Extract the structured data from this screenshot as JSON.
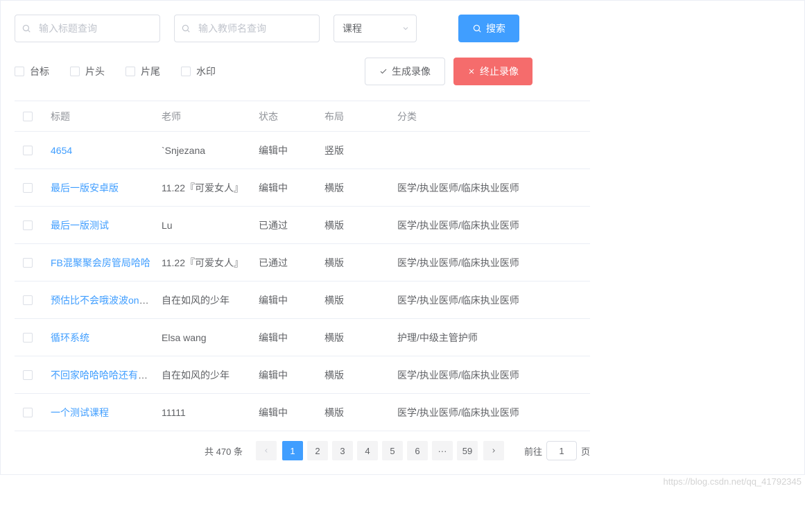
{
  "search": {
    "title_placeholder": "输入标题查询",
    "teacher_placeholder": "输入教师名查询",
    "type_value": "课程",
    "search_btn": "搜索"
  },
  "options": {
    "logo": "台标",
    "intro": "片头",
    "outro": "片尾",
    "watermark": "水印",
    "generate_btn": "生成录像",
    "stop_btn": "终止录像"
  },
  "table": {
    "headers": {
      "title": "标题",
      "teacher": "老师",
      "status": "状态",
      "layout": "布局",
      "category": "分类"
    },
    "rows": [
      {
        "title": "4654",
        "teacher": "`Snjezana",
        "status": "编辑中",
        "layout": "竖版",
        "category": ""
      },
      {
        "title": "最后一版安卓版",
        "teacher": "11.22『可爱女人』",
        "status": "编辑中",
        "layout": "横版",
        "category": "医学/执业医师/临床执业医师"
      },
      {
        "title": "最后一版测试",
        "teacher": "Lu",
        "status": "已通过",
        "layout": "横版",
        "category": "医学/执业医师/临床执业医师"
      },
      {
        "title": "FB混聚聚会房管局哈哈",
        "teacher": "11.22『可爱女人』",
        "status": "已通过",
        "layout": "横版",
        "category": "医学/执业医师/临床执业医师"
      },
      {
        "title": "预估比不会哦波波on年农历",
        "teacher": "自在如风的少年",
        "status": "编辑中",
        "layout": "横版",
        "category": "医学/执业医师/临床执业医师"
      },
      {
        "title": "循环系统",
        "teacher": "Elsa wang",
        "status": "编辑中",
        "layout": "横版",
        "category": "护理/中级主管护师"
      },
      {
        "title": "不回家哈哈哈哈还有个不不",
        "teacher": "自在如风的少年",
        "status": "编辑中",
        "layout": "横版",
        "category": "医学/执业医师/临床执业医师"
      },
      {
        "title": "一个测试课程",
        "teacher": "11111",
        "status": "编辑中",
        "layout": "横版",
        "category": "医学/执业医师/临床执业医师"
      }
    ]
  },
  "pagination": {
    "total_text": "共 470 条",
    "pages": [
      "1",
      "2",
      "3",
      "4",
      "5",
      "6",
      "···",
      "59"
    ],
    "active_page": "1",
    "goto_prefix": "前往",
    "goto_value": "1",
    "goto_suffix": "页"
  },
  "watermark": "https://blog.csdn.net/qq_41792345"
}
